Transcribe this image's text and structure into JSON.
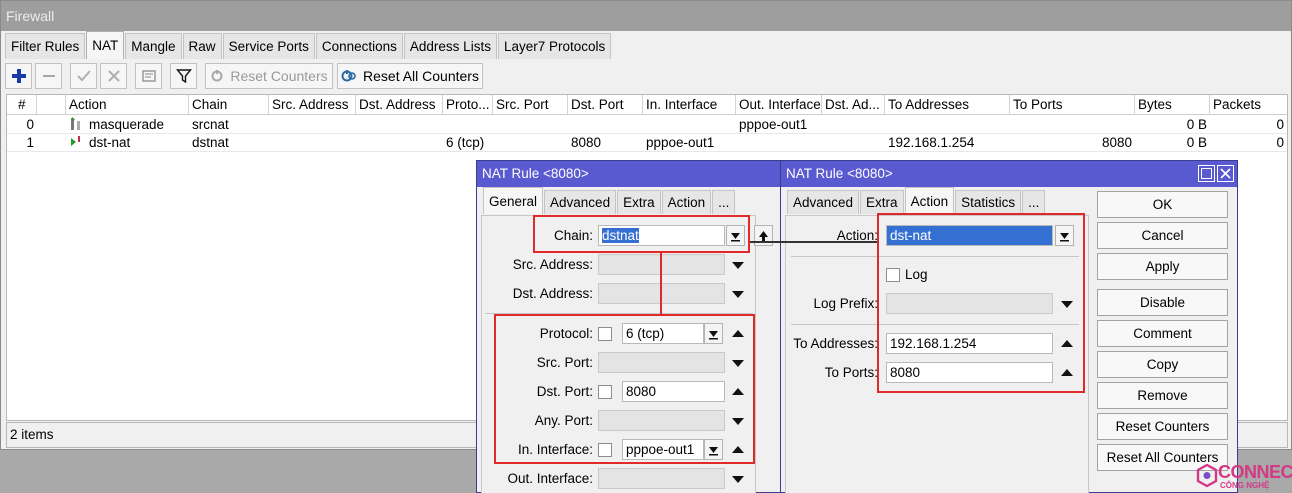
{
  "window": {
    "title": "Firewall"
  },
  "tabs": [
    {
      "label": "Filter Rules"
    },
    {
      "label": "NAT"
    },
    {
      "label": "Mangle"
    },
    {
      "label": "Raw"
    },
    {
      "label": "Service Ports"
    },
    {
      "label": "Connections"
    },
    {
      "label": "Address Lists"
    },
    {
      "label": "Layer7 Protocols"
    }
  ],
  "toolbar": {
    "add_icon": "plus-icon",
    "remove_icon": "minus-icon",
    "enable_icon": "check-icon",
    "disable_icon": "x-icon",
    "comment_icon": "note-icon",
    "filter_icon": "filter-icon",
    "reset_counters": "Reset Counters",
    "reset_all_counters": "Reset All Counters"
  },
  "table": {
    "columns": [
      "#",
      "Action",
      "Chain",
      "Src. Address",
      "Dst. Address",
      "Proto...",
      "Src. Port",
      "Dst. Port",
      "In. Interface",
      "Out. Interface",
      "Dst. Ad...",
      "To Addresses",
      "To Ports",
      "Bytes",
      "Packets"
    ],
    "rows": [
      {
        "num": "0",
        "action": "masquerade",
        "chain": "srcnat",
        "proto": "",
        "dst_port": "",
        "in_if": "",
        "out_if": "pppoe-out1",
        "to_addr": "",
        "to_ports": "",
        "bytes": "0 B",
        "packets": "0"
      },
      {
        "num": "1",
        "action": "dst-nat",
        "chain": "dstnat",
        "proto": "6 (tcp)",
        "dst_port": "8080",
        "in_if": "pppoe-out1",
        "out_if": "",
        "to_addr": "192.168.1.254",
        "to_ports": "8080",
        "bytes": "0 B",
        "packets": "0"
      }
    ]
  },
  "status": {
    "items": "2 items"
  },
  "dialog_general": {
    "title": "NAT Rule <8080>",
    "tabs": [
      "General",
      "Advanced",
      "Extra",
      "Action",
      "..."
    ],
    "chain_label": "Chain:",
    "chain_value": "dstnat",
    "src_address_label": "Src. Address:",
    "dst_address_label": "Dst. Address:",
    "protocol_label": "Protocol:",
    "protocol_value": "6 (tcp)",
    "src_port_label": "Src. Port:",
    "dst_port_label": "Dst. Port:",
    "dst_port_value": "8080",
    "any_port_label": "Any. Port:",
    "in_interface_label": "In. Interface:",
    "in_interface_value": "pppoe-out1",
    "out_interface_label": "Out. Interface:"
  },
  "dialog_action": {
    "title": "NAT Rule <8080>",
    "tabs": [
      "Advanced",
      "Extra",
      "Action",
      "Statistics",
      "..."
    ],
    "action_label": "Action:",
    "action_value": "dst-nat",
    "log_label": "Log",
    "log_prefix_label": "Log Prefix:",
    "to_addresses_label": "To Addresses:",
    "to_addresses_value": "192.168.1.254",
    "to_ports_label": "To Ports:",
    "to_ports_value": "8080",
    "buttons": {
      "ok": "OK",
      "cancel": "Cancel",
      "apply": "Apply",
      "disable": "Disable",
      "comment": "Comment",
      "copy": "Copy",
      "remove": "Remove",
      "reset_counters": "Reset Counters",
      "reset_all_counters": "Reset All Counters"
    }
  },
  "watermark": {
    "main": "CONNECT",
    "sub": "CÔNG NGHỆ"
  },
  "colors": {
    "title_bar": "#5a5ad0",
    "highlight": "#e02a2a",
    "selection": "#3470d2"
  }
}
